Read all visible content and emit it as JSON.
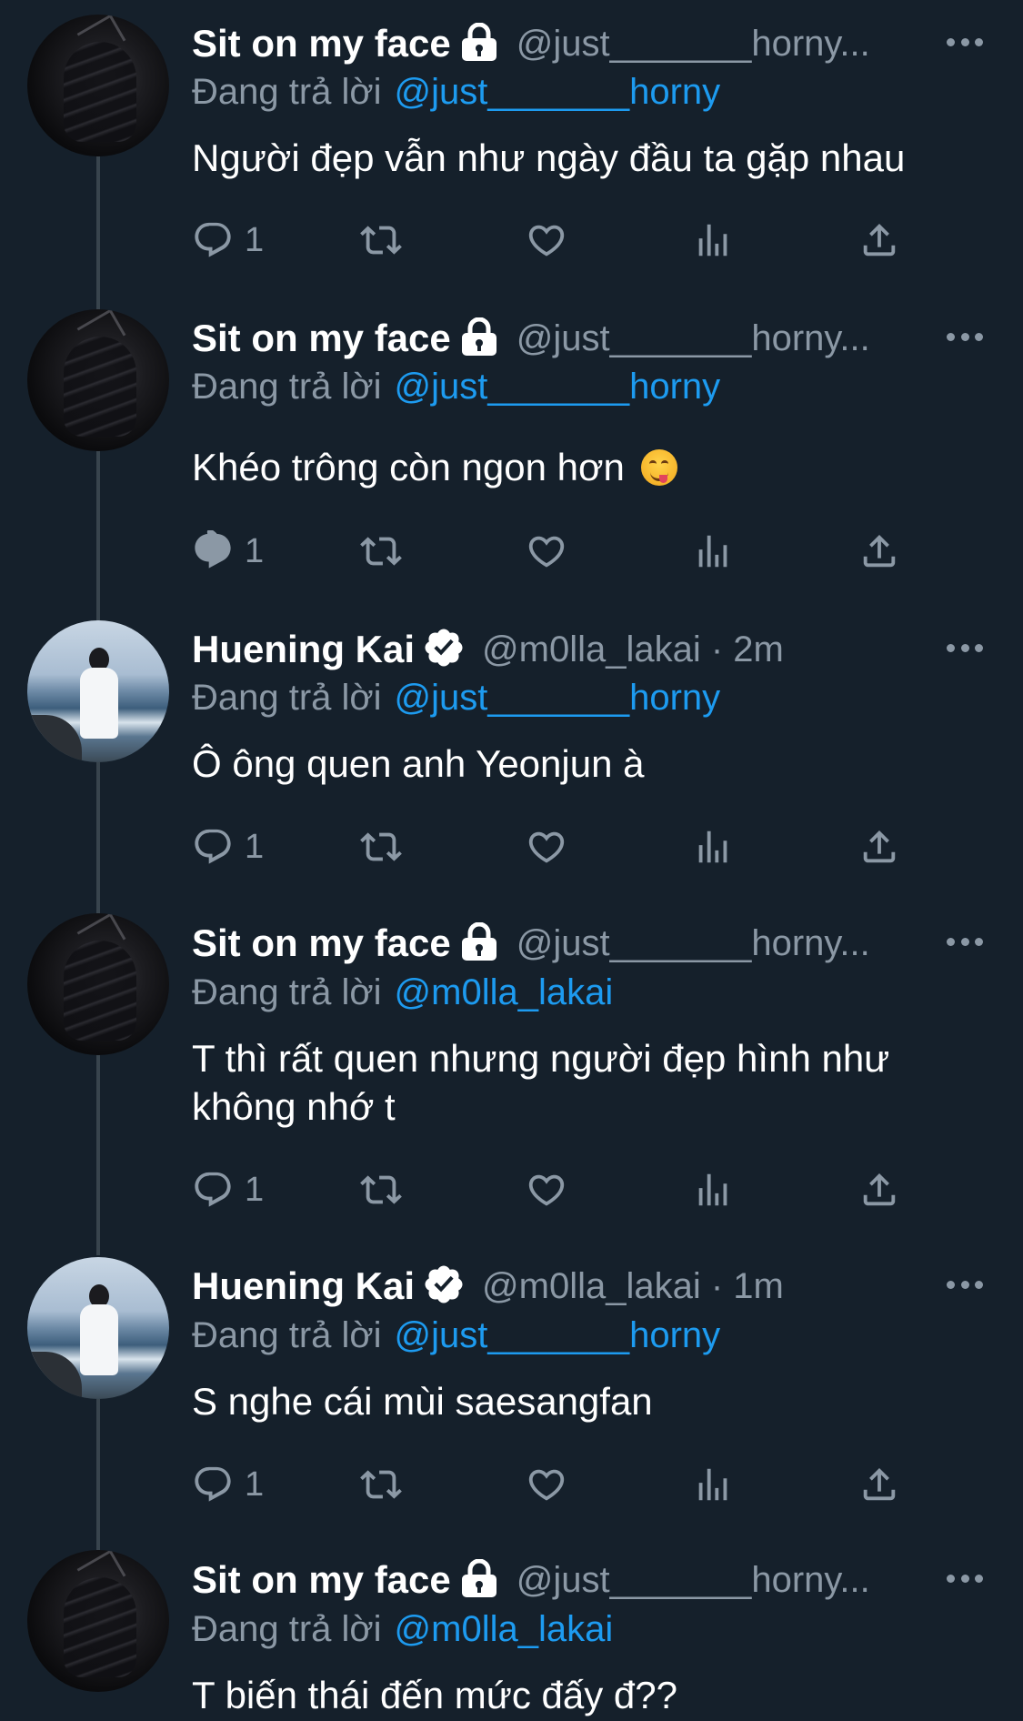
{
  "tweets": [
    {
      "name": "Sit on my face",
      "badge": "lock",
      "handle": "@just_______horny...",
      "reply_prefix": "Đang trả lời",
      "reply_to": "@just_______horny",
      "text": "Người đẹp vẫn như ngày đầu ta gặp nhau",
      "reply_count": "1",
      "avatar": "dark-avatar"
    },
    {
      "name": "Sit on my face",
      "badge": "lock",
      "handle": "@just_______horny...",
      "reply_prefix": "Đang trả lời",
      "reply_to": "@just_______horny",
      "text": "Khéo trông còn ngon hơn",
      "emoji": "face-savoring-food-emoji",
      "reply_count": "1",
      "avatar": "dark-avatar"
    },
    {
      "name": "Huening Kai",
      "badge": "verified",
      "handle": "@m0lla_lakai · 2m",
      "reply_prefix": "Đang trả lời",
      "reply_to": "@just_______horny",
      "text": "Ô ông quen anh Yeonjun à",
      "reply_count": "1",
      "avatar": "sea-avatar"
    },
    {
      "name": "Sit on my face",
      "badge": "lock",
      "handle": "@just_______horny...",
      "reply_prefix": "Đang trả lời",
      "reply_to": "@m0lla_lakai",
      "text": "T thì rất quen nhưng người đẹp hình như không nhớ t",
      "reply_count": "1",
      "avatar": "dark-avatar"
    },
    {
      "name": "Huening Kai",
      "badge": "verified",
      "handle": "@m0lla_lakai · 1m",
      "reply_prefix": "Đang trả lời",
      "reply_to": "@just_______horny",
      "text": "S nghe cái mùi saesangfan",
      "reply_count": "1",
      "avatar": "sea-avatar"
    },
    {
      "name": "Sit on my face",
      "badge": "lock",
      "handle": "@just_______horny...",
      "reply_prefix": "Đang trả lời",
      "reply_to": "@m0lla_lakai",
      "text": "T biến thái đến mức đấy đ??",
      "avatar": "dark-avatar"
    }
  ],
  "colors": {
    "background": "#15202b",
    "secondary_text": "#8b98a5",
    "mention": "#1d9bf0",
    "thread_line": "#38444d"
  }
}
